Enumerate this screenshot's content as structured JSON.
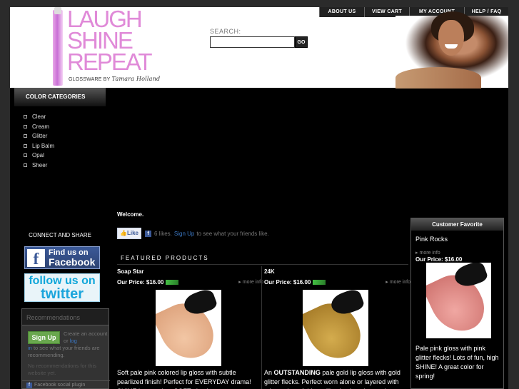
{
  "topnav": {
    "items": [
      "ABOUT US",
      "VIEW CART",
      "MY ACCOUNT",
      "HELP / FAQ"
    ]
  },
  "brand": {
    "line1": "LAUGH",
    "line2": "SHINE",
    "line3": "REPEAT",
    "sub": "GLOSSWARE BY",
    "signature": "Tamara Holland",
    "color": "#e08ad8"
  },
  "search": {
    "label": "SEARCH:",
    "value": "",
    "go_label": "GO"
  },
  "sidebar": {
    "heading": "COLOR CATEGORIES",
    "items": [
      "Clear",
      "Cream",
      "Glitter",
      "Lip Balm",
      "Opal",
      "Sheer"
    ],
    "connect_heading": "CONNECT AND SHARE",
    "facebook_badge": {
      "line1": "Find us on",
      "line2": "Facebook",
      "icon": "f"
    },
    "twitter_badge": {
      "line1": "follow us on",
      "line2": "twitter"
    },
    "recommendations": {
      "heading": "Recommendations",
      "signup_label": "Sign Up",
      "create_text_1": "Create an account or",
      "create_link": "log",
      "create_text_2": "in",
      "see_text": "to see what your friends are recommending.",
      "empty_text": "No recommendations for this website yet.",
      "footer": "Facebook social plugin"
    }
  },
  "main": {
    "welcome": "Welcome.",
    "like": {
      "button_label": "Like",
      "count_text": "6 likes.",
      "signup_link": "Sign Up",
      "suffix": "to see what your friends like."
    },
    "featured_heading": "FEATURED PRODUCTS",
    "products": [
      {
        "name": "Soap Star",
        "price_label": "Our Price: $16.00",
        "more": "more info",
        "swatch_color": "#e8b48f",
        "desc": "Soft pale pink colored lip gloss with subtle pearlized finish! Perfect for EVERYDAY drama! SHINE it up and go SOFT glam!"
      },
      {
        "name": "24K",
        "price_label": "Our Price: $16.00",
        "more": "more info",
        "swatch_color": "#b98a2c",
        "desc_prefix": "An ",
        "desc_bold": "OUTSTANDING",
        "desc": " pale gold lip gloss with gold glitter flecks. Perfect worn alone or layered with other colors. Adds an illuminating glow and"
      }
    ]
  },
  "favorite": {
    "heading": "Customer Favorite",
    "name": "Pink Rocks",
    "more": "more info",
    "price_label": "Our Price: $16.00",
    "swatch_color": "#e08a85",
    "desc": "Pale pink gloss with pink glitter flecks! Lots of fun, high SHINE! A great color for spring!"
  }
}
